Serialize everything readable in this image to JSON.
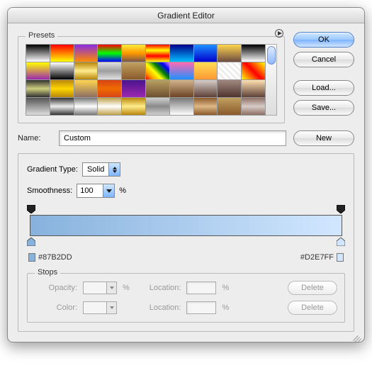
{
  "title": "Gradient Editor",
  "presets": {
    "label": "Presets",
    "swatches": [
      "linear-gradient(#000,#fff)",
      "linear-gradient(#ff0000,#ffff00)",
      "linear-gradient(#8a2be2,#ff8c00)",
      "linear-gradient(#ff0000,#00ff00,#0000ff)",
      "linear-gradient(#ffeb3b,#ff9800,#795548)",
      "linear-gradient(#ff0000,#ffff00,#ff0000,#ffff00)",
      "linear-gradient(#00008b,#00bfff)",
      "linear-gradient(#1e90ff,#0000cd)",
      "linear-gradient(#ffd54f,#6d4c41)",
      "linear-gradient(#000,#fff)",
      "linear-gradient(#ffff00,#9c27b0)",
      "linear-gradient(#fff,#000)",
      "linear-gradient(#b8860b,#ffec8b,#b8860b)",
      "linear-gradient(#e0e0e0,#9e9e9e,#e0e0e0)",
      "linear-gradient(#c0a060,#8b5a2b)",
      "linear-gradient(45deg,red,orange,yellow,green,blue,violet)",
      "linear-gradient(#ff69b4,#1e90ff)",
      "linear-gradient(#ffdd55,#ff9933)",
      "repeating-linear-gradient(45deg,#eee,#eee 3px,#fff 3px,#fff 6px)",
      "linear-gradient(45deg,#ff0,#f00,#ff0)",
      "linear-gradient(#2f2f2f,#cfcf7f,#2f2f2f)",
      "linear-gradient(#b8860b,#ffd700,#b8860b)",
      "linear-gradient(#ffd54f,#8d6e63)",
      "linear-gradient(#d84315,#ef6c00,#d84315)",
      "linear-gradient(#4a148c,#9c27b0)",
      "linear-gradient(#b8a060,#6d5030)",
      "linear-gradient(#d2b48c,#6b4226)",
      "linear-gradient(#d7ccc8,#5d4037)",
      "linear-gradient(#a1887f,#4e342e)",
      "linear-gradient(#ffe0b2,#5d4037)",
      "linear-gradient(#555,#ddd)",
      "linear-gradient(#333,#eee,#333)",
      "linear-gradient(#777,#fff,#777)",
      "linear-gradient(#bfa14a,#fff,#bfa14a)",
      "linear-gradient(#b8860b,#ffec8b,#b8860b)",
      "linear-gradient(#cfcfcf,#8a8a8a,#cfcfcf)",
      "linear-gradient(#777,#fff)",
      "linear-gradient(#8b5a2b,#deb887,#8b5a2b)",
      "linear-gradient(#c0a060,#8b5a2b)",
      "linear-gradient(#8d6e63,#d7ccc8,#8d6e63)"
    ]
  },
  "buttons": {
    "ok": "OK",
    "cancel": "Cancel",
    "load": "Load...",
    "save": "Save...",
    "new": "New",
    "delete": "Delete"
  },
  "name": {
    "label": "Name:",
    "value": "Custom"
  },
  "gradient": {
    "type_label": "Gradient Type:",
    "type_value": "Solid",
    "smooth_label": "Smoothness:",
    "smooth_value": "100",
    "percent": "%",
    "start_hex": "#87B2DD",
    "end_hex": "#D2E7FF",
    "start_color": "#87B2DD",
    "end_color": "#D2E7FF"
  },
  "stops": {
    "label": "Stops",
    "opacity_label": "Opacity:",
    "color_label": "Color:",
    "location_label": "Location:",
    "opacity_value": "",
    "color_value": "",
    "loc1": "",
    "loc2": ""
  }
}
